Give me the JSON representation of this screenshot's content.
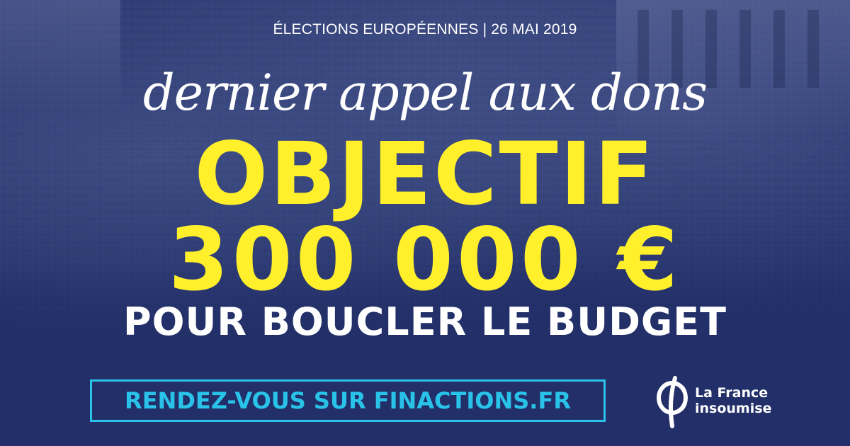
{
  "supertitle": "ÉLECTIONS EUROPÉENNES | 26 MAI 2019",
  "headline": "dernier appel aux dons",
  "goal": {
    "line1": "OBJECTIF",
    "line2": "300 000 €"
  },
  "subline": "POUR BOUCLER LE BUDGET",
  "cta": {
    "label": "RENDEZ-VOUS SUR FINACTIONS.FR"
  },
  "logo": {
    "icon": "phi-icon",
    "line1": "La France",
    "line2": "insoumise"
  },
  "colors": {
    "background": "#22306b",
    "goal_yellow": "#fff02b",
    "cta_cyan": "#29c3ea",
    "text_white": "#ffffff"
  }
}
